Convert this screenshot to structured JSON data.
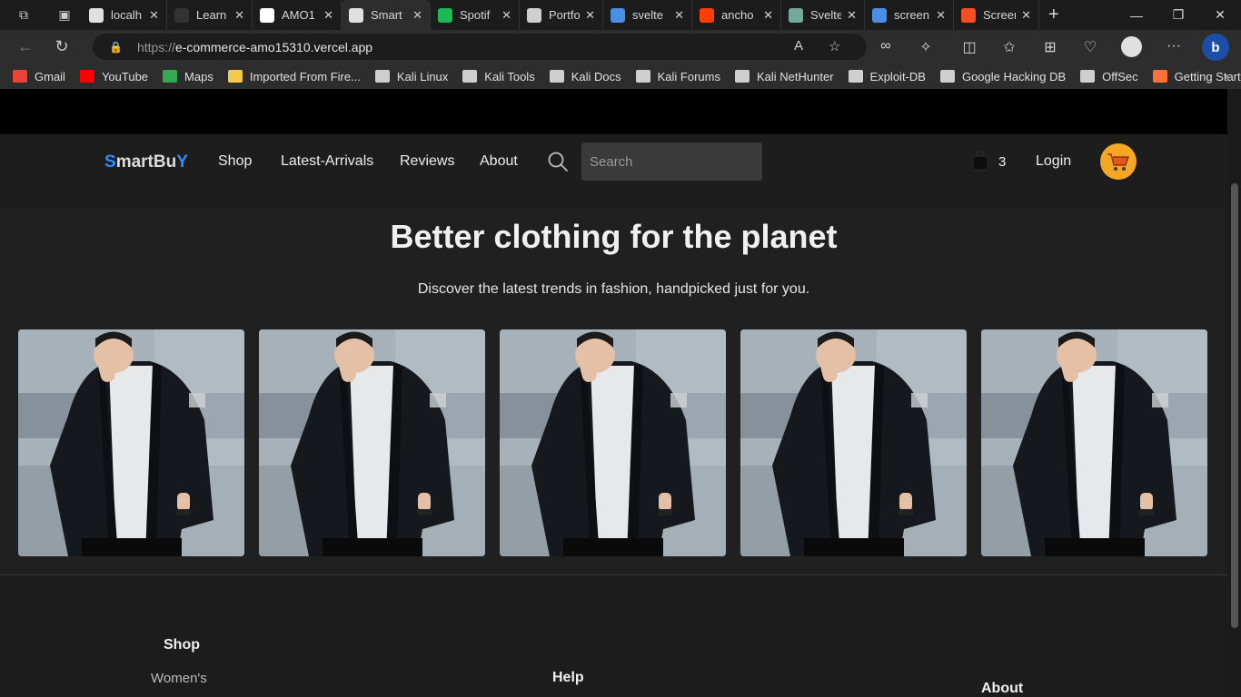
{
  "browser": {
    "tabs": [
      {
        "title": "localh",
        "icon": "file-icon",
        "color": "#e0e0e0"
      },
      {
        "title": "Learn",
        "icon": "learn-icon",
        "color": "#333333"
      },
      {
        "title": "AMO1",
        "icon": "github-icon",
        "color": "#ffffff"
      },
      {
        "title": "Smart",
        "icon": "page-icon",
        "color": "#e0e0e0",
        "active": true
      },
      {
        "title": "Spotif",
        "icon": "spotify-icon",
        "color": "#1db954"
      },
      {
        "title": "Portfo",
        "icon": "trello-icon",
        "color": "#cfcfcf"
      },
      {
        "title": "svelte",
        "icon": "search-icon",
        "color": "#4a90e2"
      },
      {
        "title": "ancho",
        "icon": "svelte-icon",
        "color": "#ff3e00"
      },
      {
        "title": "Svelte",
        "icon": "chatgpt-icon",
        "color": "#74aa9c"
      },
      {
        "title": "screen",
        "icon": "search-icon",
        "color": "#4a90e2"
      },
      {
        "title": "Screen",
        "icon": "microsoft-icon",
        "color": "#f25022"
      }
    ],
    "url_scheme": "https://",
    "url_host": "e-commerce-amo15310.vercel.app",
    "bookmarks": [
      {
        "label": "Gmail",
        "icon": "gmail-icon",
        "color": "#ea4335"
      },
      {
        "label": "YouTube",
        "icon": "youtube-icon",
        "color": "#ff0000"
      },
      {
        "label": "Maps",
        "icon": "maps-icon",
        "color": "#34a853"
      },
      {
        "label": "Imported From Fire...",
        "icon": "folder-icon",
        "color": "#f2c94c"
      },
      {
        "label": "Kali Linux",
        "icon": "kali-icon",
        "color": "#cfcfcf"
      },
      {
        "label": "Kali Tools",
        "icon": "kali-icon",
        "color": "#cfcfcf"
      },
      {
        "label": "Kali Docs",
        "icon": "kali-icon",
        "color": "#cfcfcf"
      },
      {
        "label": "Kali Forums",
        "icon": "page-icon",
        "color": "#cfcfcf"
      },
      {
        "label": "Kali NetHunter",
        "icon": "kali-icon",
        "color": "#cfcfcf"
      },
      {
        "label": "Exploit-DB",
        "icon": "page-icon",
        "color": "#cfcfcf"
      },
      {
        "label": "Google Hacking DB",
        "icon": "page-icon",
        "color": "#cfcfcf"
      },
      {
        "label": "OffSec",
        "icon": "page-icon",
        "color": "#cfcfcf"
      },
      {
        "label": "Getting Started",
        "icon": "firefox-icon",
        "color": "#ff7139"
      }
    ]
  },
  "site": {
    "logo_part1": "S",
    "logo_part2": "martBu",
    "logo_part3": "Y",
    "nav": [
      "Shop",
      "Latest-Arrivals",
      "Reviews",
      "About"
    ],
    "search_placeholder": "Search",
    "bag_count": "3",
    "login": "Login",
    "accent": "#f5a623",
    "brand_blue": "#2f8cff"
  },
  "hero": {
    "title": "Better clothing for the planet",
    "subtitle": "Discover the latest trends in fashion, handpicked just for you."
  },
  "gallery": {
    "count": 5
  },
  "footer": {
    "shop_head": "Shop",
    "shop_link": "Women's",
    "help_head": "Help",
    "about_head": "About"
  }
}
